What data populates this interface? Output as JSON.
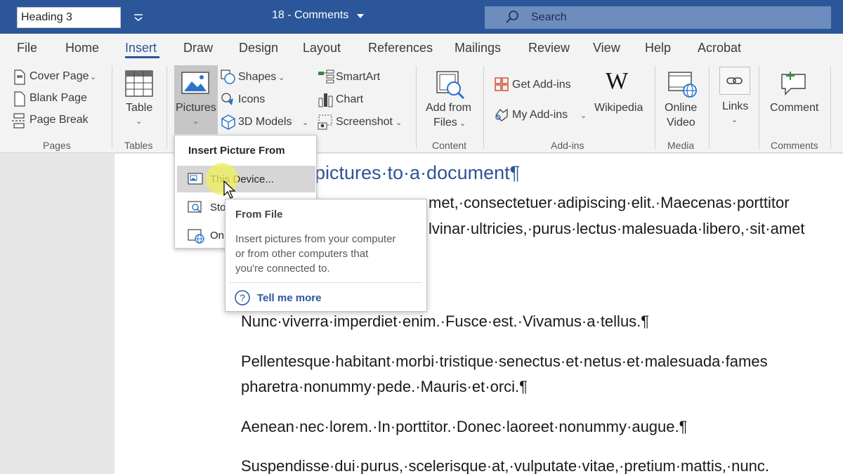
{
  "titlebar": {
    "style_box": "Heading 3",
    "doc_title": "18 - Comments",
    "search_placeholder": "Search"
  },
  "tabs": [
    "File",
    "Home",
    "Insert",
    "Draw",
    "Design",
    "Layout",
    "References",
    "Mailings",
    "Review",
    "View",
    "Help",
    "Acrobat"
  ],
  "active_tab": "Insert",
  "ribbon": {
    "pages": {
      "cover_page": "Cover Page",
      "blank_page": "Blank Page",
      "page_break": "Page Break",
      "label": "Pages"
    },
    "tables": {
      "table": "Table",
      "label": "Tables"
    },
    "illustrations": {
      "pictures": "Pictures",
      "shapes": "Shapes",
      "icons": "Icons",
      "models_3d": "3D Models",
      "smartart": "SmartArt",
      "chart": "Chart",
      "screenshot": "Screenshot"
    },
    "content": {
      "add_from_files_1": "Add from",
      "add_from_files_2": "Files",
      "label": "Content"
    },
    "addins": {
      "get_addins": "Get Add-ins",
      "my_addins": "My Add-ins",
      "wikipedia": "Wikipedia",
      "label": "Add-ins"
    },
    "media": {
      "online_video_1": "Online",
      "online_video_2": "Video",
      "label": "Media"
    },
    "links": {
      "links": "Links"
    },
    "comments": {
      "comment": "Comment",
      "label": "Comments"
    }
  },
  "menu": {
    "header": "Insert Picture From",
    "items": [
      "This Device...",
      "Sto",
      "On"
    ]
  },
  "tooltip": {
    "title": "From File",
    "lines": [
      "Insert pictures from your computer",
      "or from other computers that",
      "you're connected to."
    ],
    "link": "Tell me more"
  },
  "document": {
    "heading": "pictures·to·a·document¶",
    "line1": "met,·consectetuer·adipiscing·elit.·Maecenas·porttitor",
    "line2": "lvinar·ultricies,·purus·lectus·malesuada·libero,·sit·amet",
    "para1": "Nunc·viverra·imperdiet·enim.·Fusce·est.·Vivamus·a·tellus.¶",
    "para2a": "Pellentesque·habitant·morbi·tristique·senectus·et·netus·et·malesuada·fames",
    "para2b": "pharetra·nonummy·pede.·Mauris·et·orci.¶",
    "para3": "Aenean·nec·lorem.·In·porttitor.·Donec·laoreet·nonummy·augue.¶",
    "para4": "Suspendisse·dui·purus,·scelerisque·at,·vulputate·vitae,·pretium·mattis,·nunc."
  },
  "colors": {
    "accent": "#2b579a",
    "search_bg": "#6d8dbf",
    "ribbon_bg": "#f3f3f3",
    "heading": "#2f5496"
  }
}
